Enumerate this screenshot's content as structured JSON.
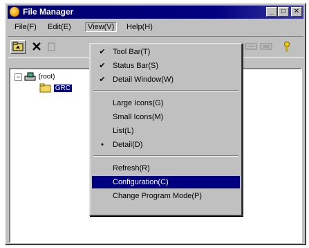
{
  "window": {
    "title": "File Manager",
    "minimize": "_",
    "maximize": "□",
    "close": "✕"
  },
  "menubar": {
    "items": [
      "File(F)",
      "Edit(E)",
      "View(V)",
      "Help(H)"
    ]
  },
  "tree": {
    "root_label": "(root)",
    "selected_label": "GRC",
    "expand": "−"
  },
  "view_menu": {
    "items": [
      {
        "label": "Tool Bar(T)",
        "mark": "✔"
      },
      {
        "label": "Status Bar(S)",
        "mark": "✔"
      },
      {
        "label": "Detail Window(W)",
        "mark": "✔"
      },
      {
        "label": "Large Icons(G)",
        "mark": ""
      },
      {
        "label": "Small Icons(M)",
        "mark": ""
      },
      {
        "label": "List(L)",
        "mark": ""
      },
      {
        "label": "Detail(D)",
        "mark": "•"
      },
      {
        "label": "Refresh(R)",
        "mark": ""
      },
      {
        "label": "Configuration(C)",
        "mark": "",
        "highlighted": true
      },
      {
        "label": "Change Program Mode(P)",
        "mark": ""
      }
    ]
  },
  "colors": {
    "highlight": "#000080",
    "face": "#c0c0c0",
    "titlebar": "#000080"
  }
}
